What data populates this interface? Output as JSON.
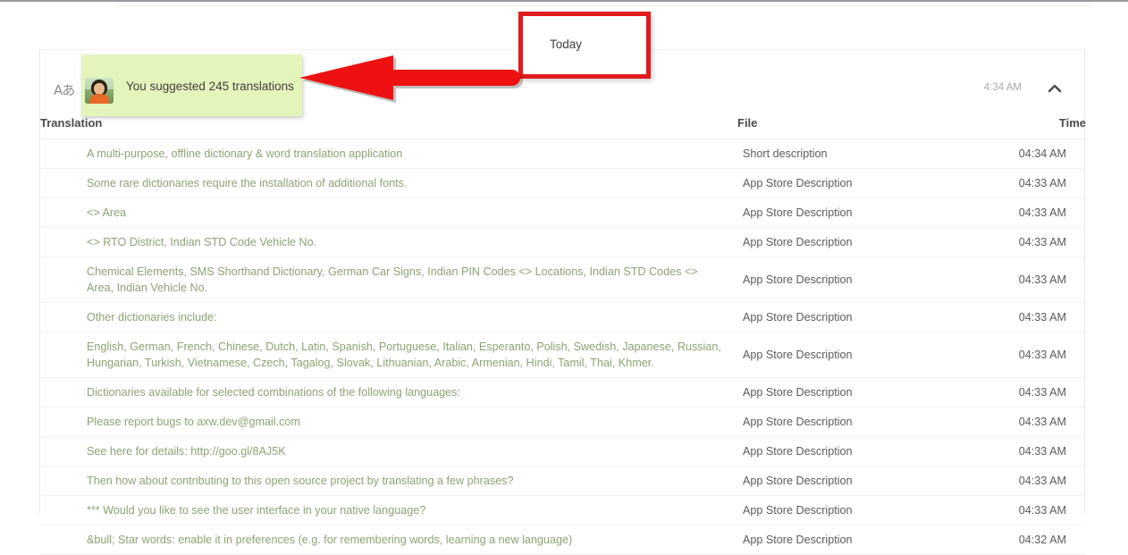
{
  "card": {
    "translate_icon_glyph": "Aあ",
    "headline": "You suggested 245 translations",
    "time": "4:34 AM",
    "collapse_icon": "chevron-up-icon",
    "avatar_alt": "user-avatar"
  },
  "annotations": {
    "today_label": "Today",
    "today_box_color": "#e01b1b",
    "arrow_color": "#ee1111",
    "highlight_color": "#e4f5bc"
  },
  "table": {
    "columns": [
      "Translation",
      "File",
      "Time"
    ],
    "rows": [
      {
        "translation": "A multi-purpose, offline dictionary & word translation application",
        "file": "Short description",
        "time": "04:34 AM"
      },
      {
        "translation": "Some rare dictionaries require the installation of additional fonts.",
        "file": "App Store Description",
        "time": "04:33 AM"
      },
      {
        "translation": "<> Area",
        "file": "App Store Description",
        "time": "04:33 AM"
      },
      {
        "translation": "<> RTO District, Indian STD Code Vehicle No.",
        "file": "App Store Description",
        "time": "04:33 AM"
      },
      {
        "translation": "Chemical Elements, SMS Shorthand Dictionary, German Car Signs, Indian PIN Codes <> Locations, Indian STD Codes <> Area, Indian Vehicle No.",
        "file": "App Store Description",
        "time": "04:33 AM"
      },
      {
        "translation": "Other dictionaries include:",
        "file": "App Store Description",
        "time": "04:33 AM"
      },
      {
        "translation": "English, German, French, Chinese, Dutch, Latin, Spanish, Portuguese, Italian, Esperanto, Polish, Swedish, Japanese, Russian, Hungarian, Turkish, Vietnamese, Czech, Tagalog, Slovak, Lithuanian, Arabic, Armenian, Hindi, Tamil, Thai, Khmer.",
        "file": "App Store Description",
        "time": "04:33 AM"
      },
      {
        "translation": "Dictionaries available for selected combinations of the following languages:",
        "file": "App Store Description",
        "time": "04:33 AM"
      },
      {
        "translation": "Please report bugs to axw.dev@gmail.com",
        "file": "App Store Description",
        "time": "04:33 AM"
      },
      {
        "translation": "See here for details: http://goo.gl/8AJ5K",
        "file": "App Store Description",
        "time": "04:33 AM"
      },
      {
        "translation": "Then how about contributing to this open source project by translating a few phrases?",
        "file": "App Store Description",
        "time": "04:33 AM"
      },
      {
        "translation": "*** Would you like to see the user interface in your native language?",
        "file": "App Store Description",
        "time": "04:33 AM"
      },
      {
        "translation": "&bull; Star words: enable it in preferences (e.g. for remembering words, learning a new language)",
        "file": "App Store Description",
        "time": "04:32 AM"
      }
    ]
  }
}
